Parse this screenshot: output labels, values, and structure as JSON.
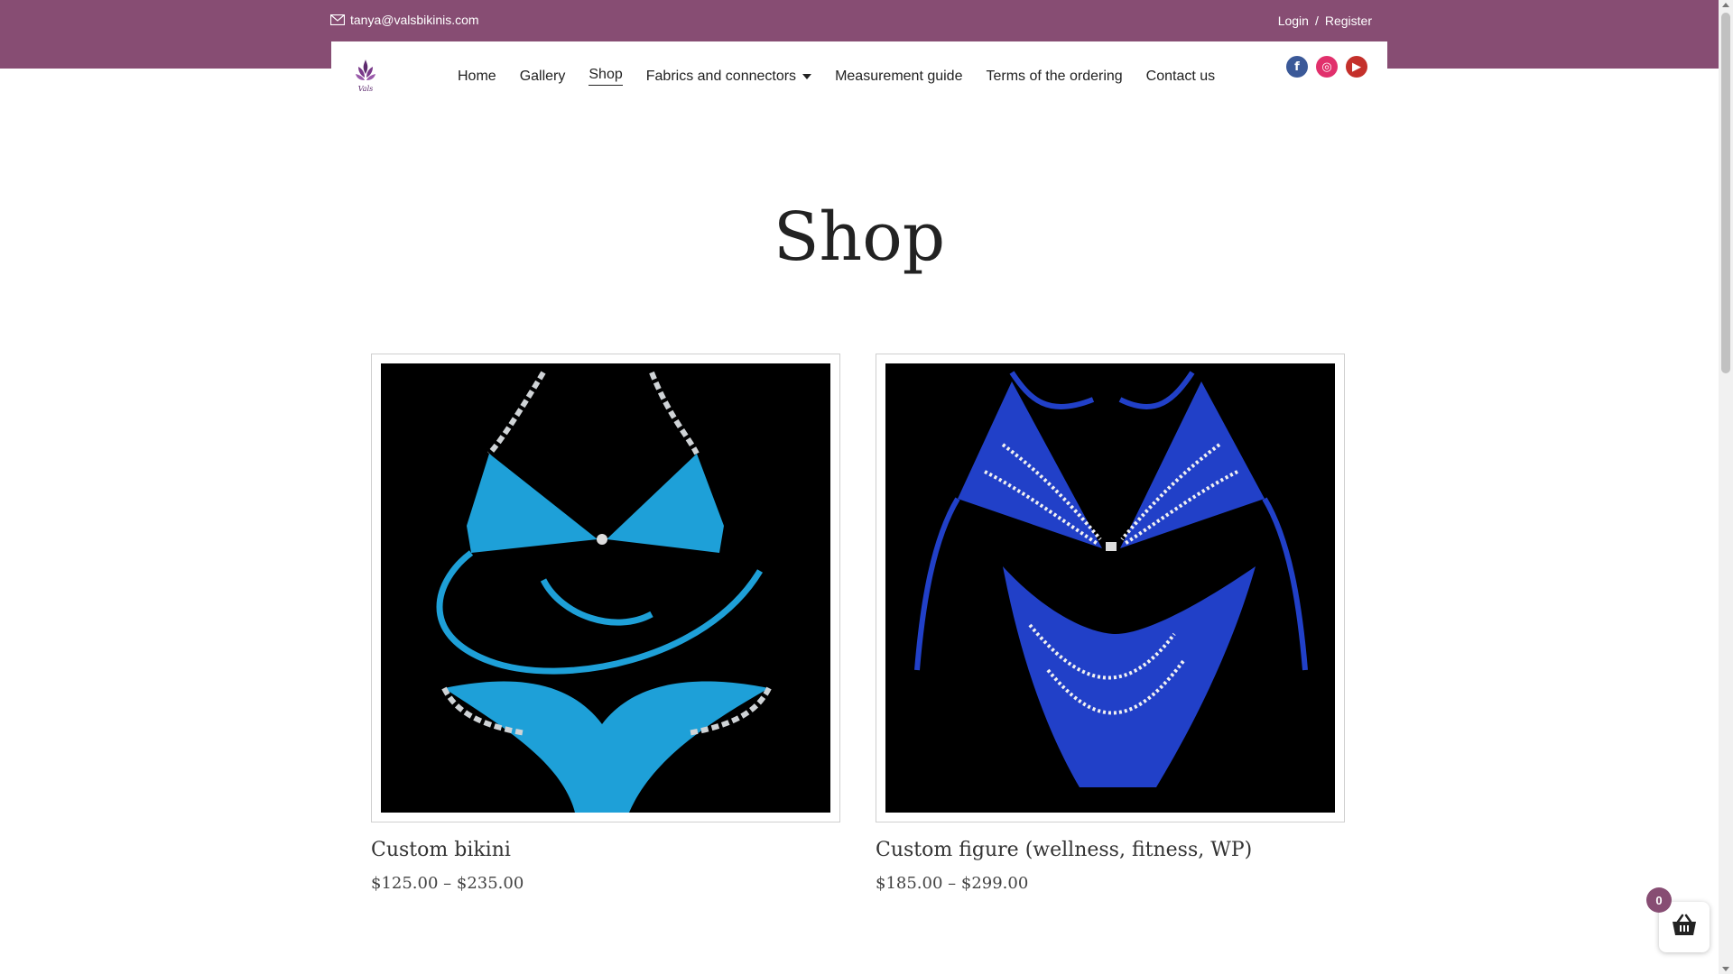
{
  "topbar": {
    "email": "tanya@valsbikinis.com",
    "login": "Login",
    "separator": "/",
    "register": "Register"
  },
  "brand": {
    "logo_text": "Vals"
  },
  "nav": {
    "items": [
      {
        "label": "Home"
      },
      {
        "label": "Gallery"
      },
      {
        "label": "Shop"
      },
      {
        "label": "Fabrics and connectors"
      },
      {
        "label": "Measurement guide"
      },
      {
        "label": "Terms of the ordering"
      },
      {
        "label": "Contact us"
      }
    ],
    "active": "Shop"
  },
  "social": {
    "facebook": {
      "glyph": "f",
      "color": "#3b5998"
    },
    "instagram": {
      "glyph": "◎",
      "color": "#e1306c"
    },
    "youtube": {
      "glyph": "▶",
      "color": "#c4302b"
    }
  },
  "page": {
    "title": "Shop"
  },
  "products": [
    {
      "name": "Custom bikini",
      "price": "$125.00 – $235.00",
      "image_color": "#1ea0d8"
    },
    {
      "name": "Custom figure (wellness, fitness, WP)",
      "price": "$185.00 – $299.00",
      "image_color": "#2140c8"
    }
  ],
  "cart": {
    "count": "0"
  },
  "colors": {
    "brand": "#874d73"
  }
}
